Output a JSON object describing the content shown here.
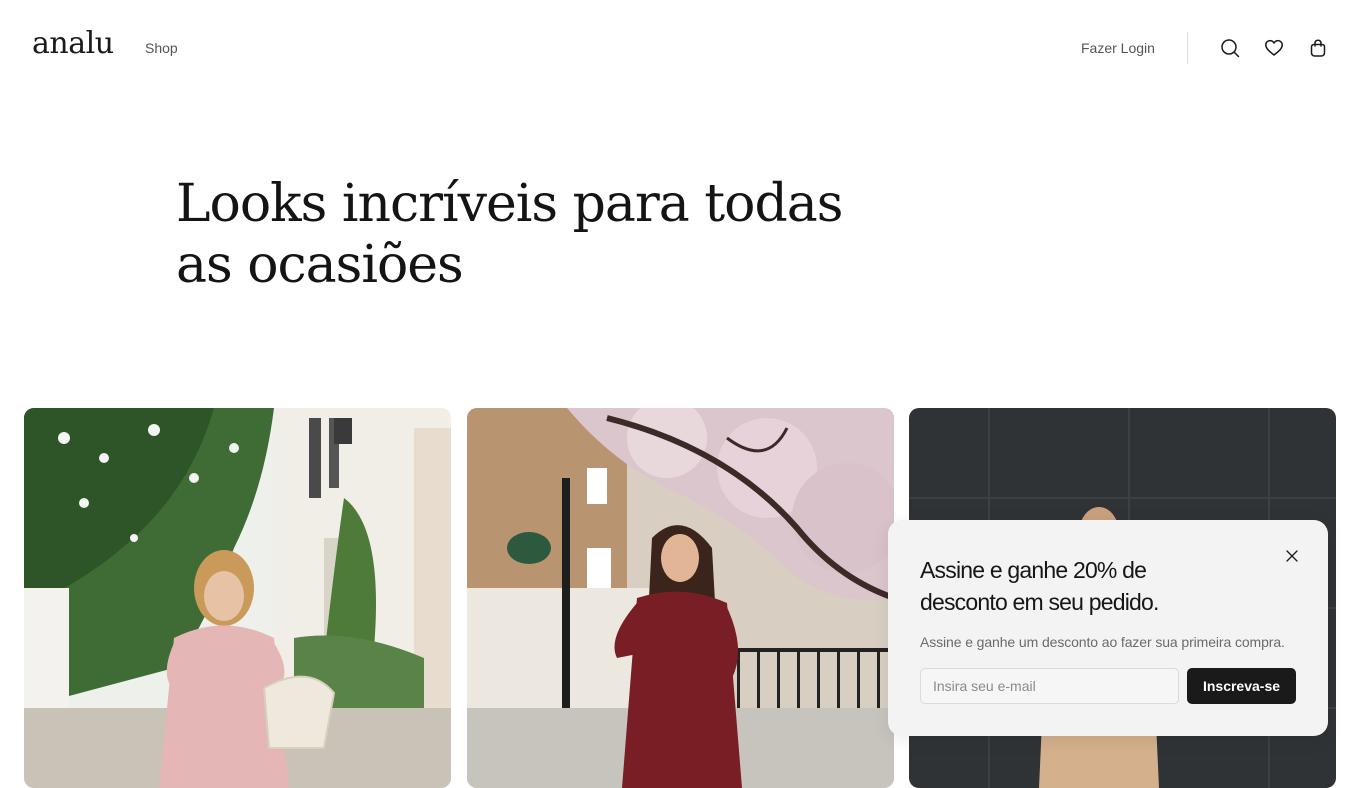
{
  "header": {
    "logo": "analu",
    "nav": [
      "Shop"
    ],
    "login_label": "Fazer Login",
    "icons": [
      "search-icon",
      "heart-icon",
      "shopping-bag-icon"
    ]
  },
  "hero": {
    "title_line1": "Looks incríveis para todas",
    "title_line2": "as ocasiões"
  },
  "cards": [
    {
      "image": "woman in pink gingham dress with woven bag on flowered street"
    },
    {
      "image": "woman in burgundy floral dress under cherry blossom tree"
    },
    {
      "image": "woman in beige outfit in front of dark panel wall"
    }
  ],
  "popup": {
    "title": "Assine e ganhe 20% de desconto em seu pedido.",
    "subtitle": "Assine e ganhe um desconto ao fazer sua primeira compra.",
    "input_placeholder": "Insira seu e-mail",
    "button_label": "Inscreva-se",
    "close_icon": "close-icon"
  },
  "colors": {
    "text": "#1a1a1a",
    "muted": "#6b6b6b",
    "popup_bg": "#f3f3f3",
    "button_bg": "#1a1a1a"
  }
}
